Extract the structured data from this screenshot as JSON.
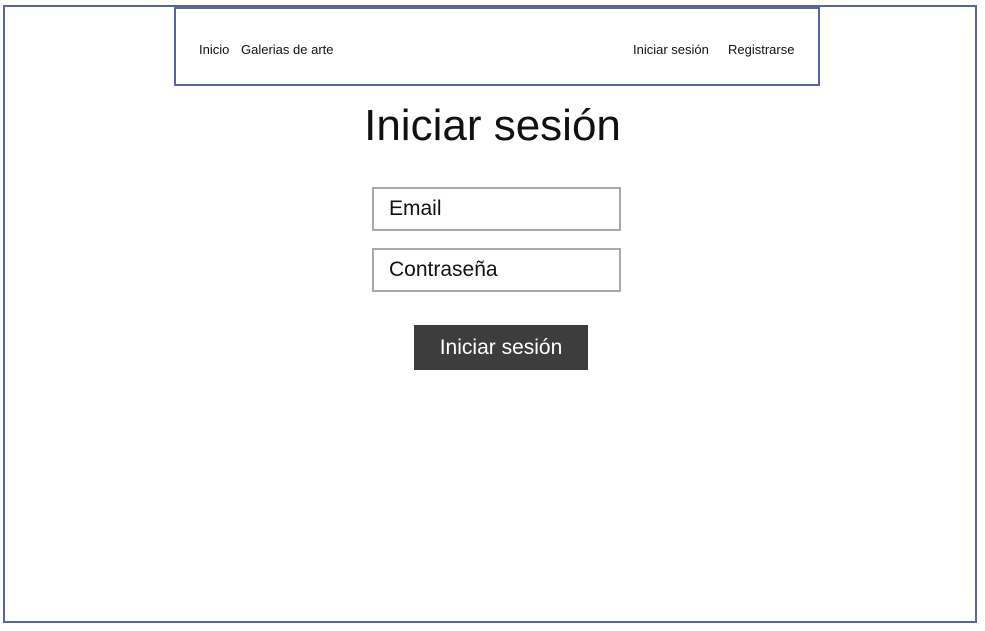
{
  "nav": {
    "items": [
      {
        "label": "Inicio"
      },
      {
        "label": "Galerias de arte"
      },
      {
        "label": "Iniciar sesión"
      },
      {
        "label": "Registrarse"
      }
    ]
  },
  "login": {
    "title": "Iniciar sesión",
    "email_placeholder": "Email",
    "password_placeholder": "Contraseña",
    "submit_label": "Iniciar sesión"
  },
  "colors": {
    "frame_border": "#5a63a3",
    "input_border": "#a9a9a9",
    "button_background": "#3d3d3d",
    "button_text": "#ffffff"
  }
}
